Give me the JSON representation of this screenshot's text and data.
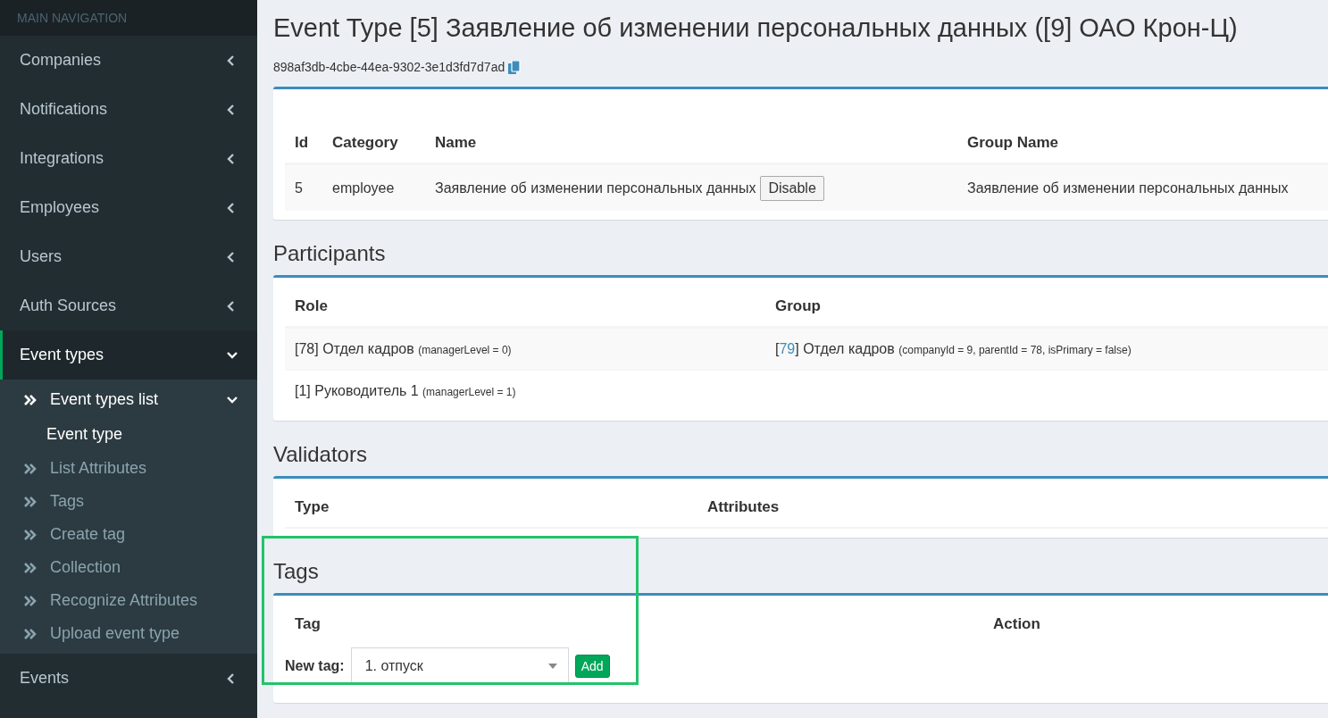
{
  "sidebar": {
    "header": "MAIN NAVIGATION",
    "items": [
      {
        "label": "Companies",
        "expanded": false,
        "selected": false
      },
      {
        "label": "Notifications",
        "expanded": false,
        "selected": false
      },
      {
        "label": "Integrations",
        "expanded": false,
        "selected": false
      },
      {
        "label": "Employees",
        "expanded": false,
        "selected": false
      },
      {
        "label": "Users",
        "expanded": false,
        "selected": false
      },
      {
        "label": "Auth Sources",
        "expanded": false,
        "selected": false
      },
      {
        "label": "Event types",
        "expanded": true,
        "selected": true,
        "children": [
          {
            "label": "Event types list",
            "expanded": true,
            "selected": true,
            "children": [
              {
                "label": "Event type",
                "selected": true
              }
            ]
          },
          {
            "label": "List Attributes",
            "selected": false
          },
          {
            "label": "Tags",
            "selected": false
          },
          {
            "label": "Create tag",
            "selected": false
          },
          {
            "label": "Collection",
            "selected": false
          },
          {
            "label": "Recognize Attributes",
            "selected": false
          },
          {
            "label": "Upload event type",
            "selected": false
          }
        ]
      },
      {
        "label": "Events",
        "expanded": false,
        "selected": false
      }
    ]
  },
  "page": {
    "title": "Event Type [5] Заявление об изменении персональных данных ([9] ОАО Крон-Ц)",
    "uuid": "898af3db-4cbe-44ea-9302-3e1d3fd7d7ad"
  },
  "event_table": {
    "columns": [
      "Id",
      "Category",
      "Name",
      "Group Name"
    ],
    "rows": [
      {
        "id": "5",
        "category": "employee",
        "name": "Заявление об изменении персональных данных",
        "button": "Disable",
        "group_name": "Заявление об изменении персональных данных"
      }
    ]
  },
  "participants": {
    "title": "Participants",
    "columns": [
      "Role",
      "Group"
    ],
    "rows": [
      {
        "role": "[78] Отдел кадров",
        "role_note": "(managerLevel = 0)",
        "group_open": "[",
        "group_id": "79",
        "group_close": "]",
        "group_name": "Отдел кадров",
        "group_note": "(companyId = 9, parentId = 78, isPrimary = false)"
      },
      {
        "role": "[1] Руководитель 1",
        "role_note": "(managerLevel = 1)"
      }
    ]
  },
  "validators": {
    "title": "Validators",
    "columns": [
      "Type",
      "Attributes"
    ]
  },
  "tags": {
    "title": "Tags",
    "highlighted": true,
    "columns": [
      "Tag",
      "Action"
    ],
    "new_tag_label": "New tag:",
    "select_value": "1. отпуск",
    "add_button": "Add"
  }
}
